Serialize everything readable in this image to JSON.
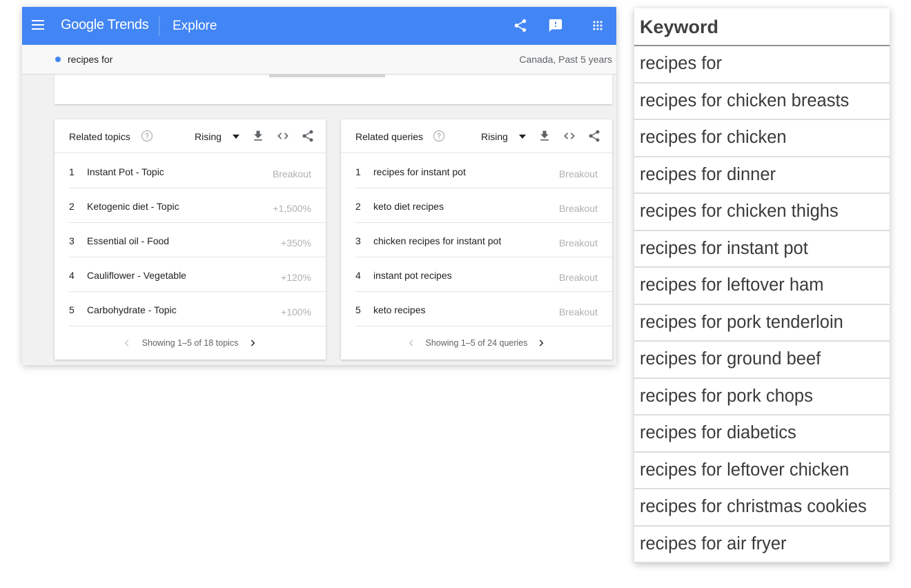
{
  "app": {
    "logo": "Google Trends",
    "page_title": "Explore"
  },
  "search": {
    "term": "recipes for",
    "scope": "Canada, Past 5 years",
    "term_color": "#4285f4"
  },
  "colors": {
    "header_bg": "#4285f4",
    "muted_value": "#b0b0b0"
  },
  "topbar_icons": [
    "menu-icon",
    "share-icon",
    "feedback-icon",
    "apps-icon"
  ],
  "related_topics": {
    "title": "Related topics",
    "filter": "Rising",
    "rows": [
      {
        "rank": "1",
        "label": "Instant Pot - Topic",
        "value": "Breakout"
      },
      {
        "rank": "2",
        "label": "Ketogenic diet - Topic",
        "value": "+1,500%"
      },
      {
        "rank": "3",
        "label": "Essential oil - Food",
        "value": "+350%"
      },
      {
        "rank": "4",
        "label": "Cauliflower - Vegetable",
        "value": "+120%"
      },
      {
        "rank": "5",
        "label": "Carbohydrate - Topic",
        "value": "+100%"
      }
    ],
    "pager": "Showing 1–5 of 18 topics"
  },
  "related_queries": {
    "title": "Related queries",
    "filter": "Rising",
    "rows": [
      {
        "rank": "1",
        "label": "recipes for instant pot",
        "value": "Breakout"
      },
      {
        "rank": "2",
        "label": "keto diet recipes",
        "value": "Breakout"
      },
      {
        "rank": "3",
        "label": "chicken recipes for instant pot",
        "value": "Breakout"
      },
      {
        "rank": "4",
        "label": "instant pot recipes",
        "value": "Breakout"
      },
      {
        "rank": "5",
        "label": "keto recipes",
        "value": "Breakout"
      }
    ],
    "pager": "Showing 1–5 of 24 queries"
  },
  "keyword_table": {
    "header": "Keyword",
    "rows": [
      "recipes for",
      "recipes for chicken breasts",
      "recipes for chicken",
      "recipes for dinner",
      "recipes for chicken thighs",
      "recipes for instant pot",
      "recipes for leftover ham",
      "recipes for pork tenderloin",
      "recipes for ground beef",
      "recipes for pork chops",
      "recipes for diabetics",
      "recipes for leftover chicken",
      "recipes for christmas cookies",
      "recipes for air fryer"
    ]
  }
}
